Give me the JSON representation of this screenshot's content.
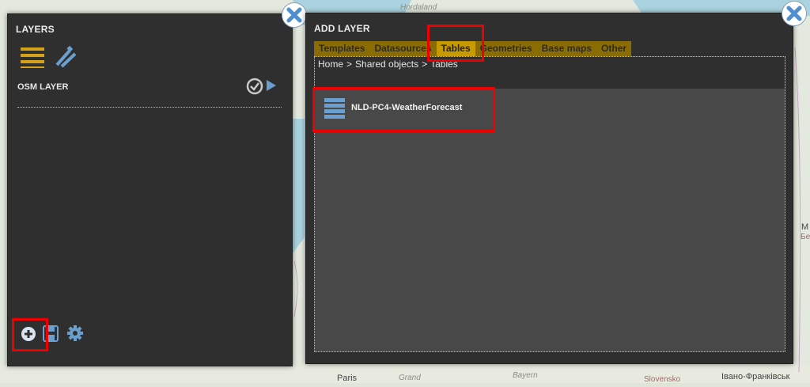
{
  "map": {
    "labels": [
      "Hordaland",
      "Paris",
      "Grand",
      "Bayern",
      "Slovensko",
      "Івано-Франківськ",
      "M",
      "Бе"
    ]
  },
  "layers_panel": {
    "title": "LAYERS",
    "layer_name": "OSM LAYER",
    "toolbar_icons": [
      "list-icon",
      "edit-pen-icon"
    ],
    "bottom_tools": [
      "add-circle-icon",
      "save-disk-icon",
      "gear-icon"
    ]
  },
  "add_layer_panel": {
    "title": "ADD LAYER",
    "tabs": [
      {
        "label": "Templates",
        "active": false
      },
      {
        "label": "Datasources",
        "active": false
      },
      {
        "label": "Tables",
        "active": true
      },
      {
        "label": "Geometries",
        "active": false
      },
      {
        "label": "Base maps",
        "active": false
      },
      {
        "label": "Other",
        "active": false
      }
    ],
    "breadcrumb": [
      "Home",
      "Shared objects",
      "Tables"
    ],
    "breadcrumb_separator": ">",
    "items": [
      {
        "name": "NLD-PC4-WeatherForecast",
        "icon": "table-icon"
      }
    ]
  },
  "colors": {
    "panel_bg": "#2f2f2f",
    "tab_bar": "#8a6c05",
    "tab_active": "#c79b00",
    "icon_blue": "#6a9fd0",
    "icon_gold": "#d4a11a",
    "highlight": "#ee0000"
  }
}
